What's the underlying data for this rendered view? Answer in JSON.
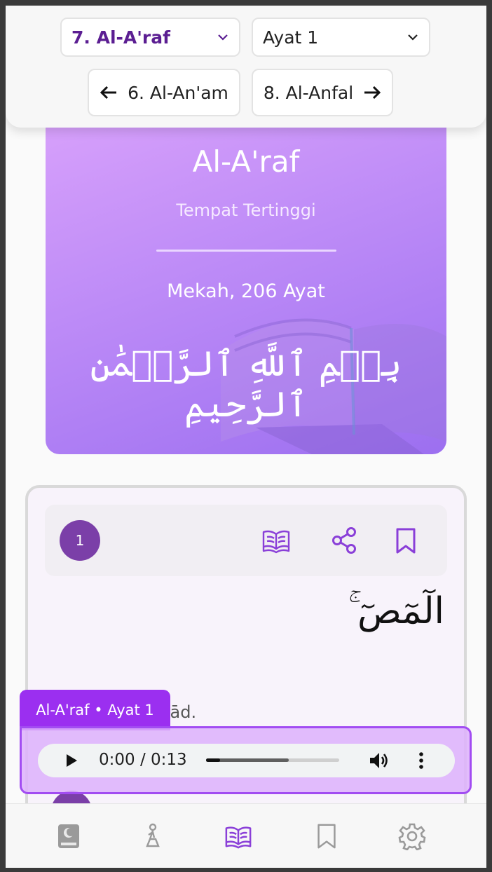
{
  "top_nav": {
    "surah_select": "7. Al-A'raf",
    "ayat_select": "Ayat 1",
    "prev_surah": "6. Al-An'am",
    "next_surah": "8. Al-Anfal"
  },
  "surah_header": {
    "name": "Al-A'raf",
    "meaning": "Tempat Tertinggi",
    "place_and_count": "Mekah, 206 Ayat",
    "basmala": "بِسۡمِ ٱللَّهِ ٱلرَّحۡمَٰنِ ٱلرَّحِيمِ"
  },
  "verse": {
    "number": "1",
    "arabic": "الٓمٓصٓ ۚ",
    "transliteration": "Alif Lām Mīm Ṣād."
  },
  "audio": {
    "label": "Al-A'raf • Ayat 1",
    "time": "0:00 / 0:13",
    "progress": 0,
    "buffered": 0.62
  },
  "bottom_nav": {
    "items": [
      "quran-icon",
      "prayer-icon",
      "tafsir-icon",
      "bookmark-icon",
      "settings-icon"
    ],
    "active": "tafsir-icon"
  },
  "colors": {
    "accent": "#7b3fa8",
    "brand_purple": "#9b2ff0",
    "header_gradient_start": "#d9a2fb",
    "header_gradient_end": "#9c6ff0",
    "inactive_icon": "#888888"
  }
}
